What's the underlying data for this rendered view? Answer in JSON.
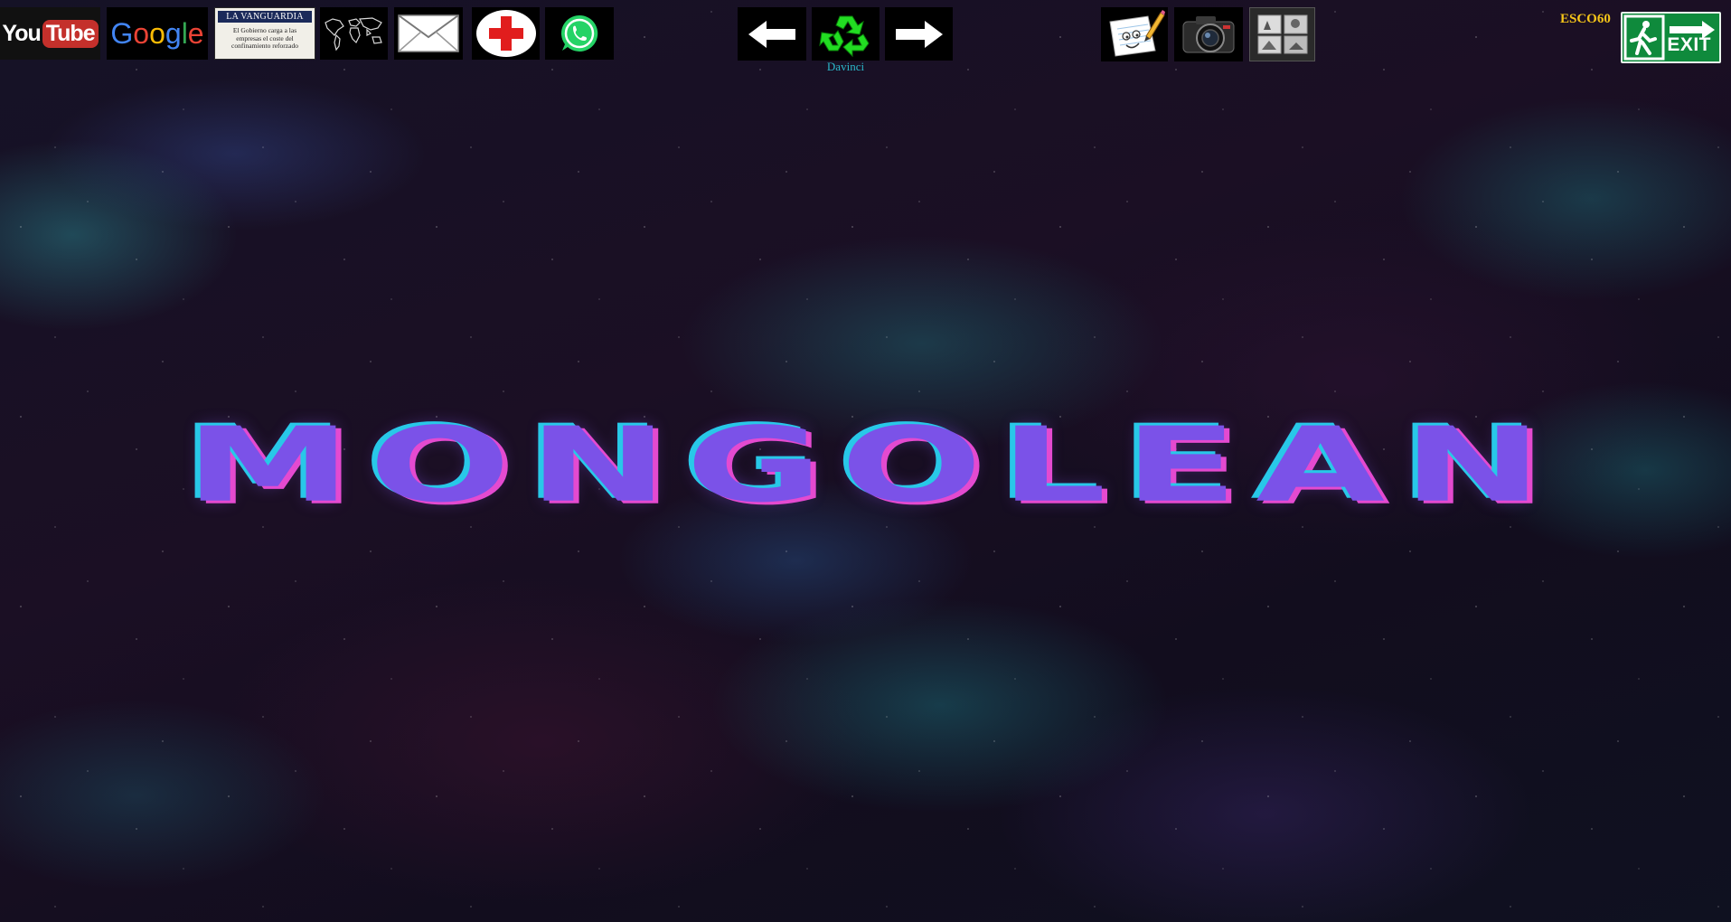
{
  "toolbar": {
    "youtube": {
      "label_you": "You",
      "label_tube": "Tube",
      "icon": "youtube-logo"
    },
    "google": {
      "letters": [
        "G",
        "o",
        "o",
        "g",
        "l",
        "e"
      ],
      "colors": [
        "#4285F4",
        "#EA4335",
        "#FBBC05",
        "#4285F4",
        "#34A853",
        "#EA4335"
      ]
    },
    "vanguardia": {
      "masthead": "LA VANGUARDIA",
      "headline": "El Gobierno carga a las empresas el coste del confinamiento reforzado"
    },
    "world_map": {
      "icon": "world-map-icon"
    },
    "mail": {
      "icon": "envelope-icon"
    },
    "first_aid": {
      "icon": "red-cross-icon",
      "color": "#e11d1d"
    },
    "whatsapp": {
      "icon": "whatsapp-icon",
      "color": "#25D366"
    },
    "back": {
      "icon": "arrow-left-icon"
    },
    "recycle": {
      "icon": "recycle-icon",
      "caption": "Davinci",
      "color": "#22dd22"
    },
    "forward": {
      "icon": "arrow-right-icon"
    },
    "notepad": {
      "icon": "notepad-pencil-icon"
    },
    "camera": {
      "icon": "camera-icon"
    },
    "gallery": {
      "icon": "photo-gallery-icon"
    },
    "user": "ESCO60",
    "exit": {
      "label": "EXIT",
      "icon": "exit-sign-icon",
      "color": "#0f8a3c"
    }
  },
  "main": {
    "title": "MONGOLEAN"
  },
  "colors": {
    "title_fill": "#7b52e8",
    "title_cyan": "#28c8e8",
    "title_magenta": "#e44ad0",
    "user_label": "#f5c518"
  }
}
